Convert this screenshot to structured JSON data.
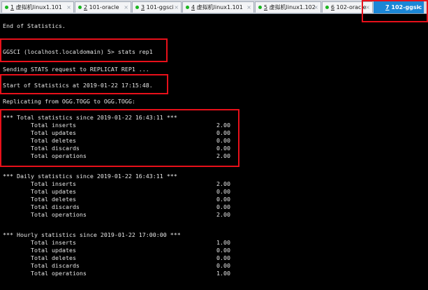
{
  "tabs": [
    {
      "num": "1",
      "title": "虚拟机linux1.101",
      "active": false
    },
    {
      "num": "2",
      "title": "101-oracle",
      "active": false
    },
    {
      "num": "3",
      "title": "101-ggsci",
      "active": false
    },
    {
      "num": "4",
      "title": "虚拟机linux1.101",
      "active": false
    },
    {
      "num": "5",
      "title": "虚拟机linux1.102",
      "active": false
    },
    {
      "num": "6",
      "title": "102-oracle",
      "active": false
    },
    {
      "num": "7",
      "title": "102-ggsic",
      "active": true
    }
  ],
  "close_glyph": "×",
  "colors": {
    "highlight": "#e8101a",
    "active_tab": "#1b86d6",
    "tab_dot": "#19b61f"
  },
  "terminal": {
    "end_of_statistics": "End of Statistics.",
    "prompt": "GGSCI (localhost.localdomain) 5> stats rep1",
    "sending": "Sending STATS request to REPLICAT REP1 ...",
    "start": "Start of Statistics at 2019-01-22 17:15:48.",
    "replicating": "Replicating from OGG.TOGG to OGG.TOGG:",
    "sections": [
      {
        "header": "*** Total statistics since 2019-01-22 16:43:11 ***",
        "rows": [
          {
            "name": "Total inserts",
            "value": "2.00"
          },
          {
            "name": "Total updates",
            "value": "0.00"
          },
          {
            "name": "Total deletes",
            "value": "0.00"
          },
          {
            "name": "Total discards",
            "value": "0.00"
          },
          {
            "name": "Total operations",
            "value": "2.00"
          }
        ]
      },
      {
        "header": "*** Daily statistics since 2019-01-22 16:43:11 ***",
        "rows": [
          {
            "name": "Total inserts",
            "value": "2.00"
          },
          {
            "name": "Total updates",
            "value": "0.00"
          },
          {
            "name": "Total deletes",
            "value": "0.00"
          },
          {
            "name": "Total discards",
            "value": "0.00"
          },
          {
            "name": "Total operations",
            "value": "2.00"
          }
        ]
      },
      {
        "header": "*** Hourly statistics since 2019-01-22 17:00:00 ***",
        "rows": [
          {
            "name": "Total inserts",
            "value": "1.00"
          },
          {
            "name": "Total updates",
            "value": "0.00"
          },
          {
            "name": "Total deletes",
            "value": "0.00"
          },
          {
            "name": "Total discards",
            "value": "0.00"
          },
          {
            "name": "Total operations",
            "value": "1.00"
          }
        ]
      }
    ]
  }
}
